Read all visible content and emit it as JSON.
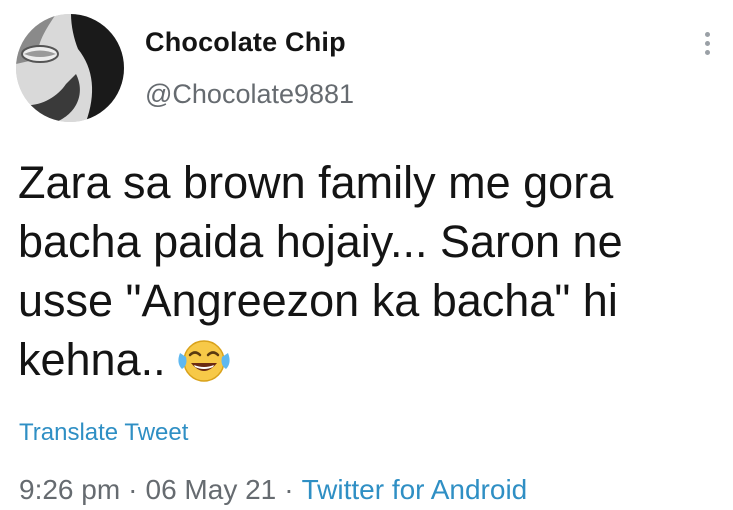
{
  "tweet": {
    "author_name": "Chocolate Chip",
    "author_handle": "@Chocolate9881",
    "text": "Zara sa brown family me gora\nbacha paida hojaiy... Saron ne\nusse \"Angreezon ka bacha\" hi\nkehna..",
    "emoji": "face-with-tears-of-joy-icon",
    "translate_label": "Translate Tweet",
    "time": "9:26 pm",
    "date": "06 May 21",
    "source": "Twitter for Android",
    "separator": "·"
  },
  "icons": {
    "more": "more-vertical-icon",
    "avatar": "avatar"
  },
  "colors": {
    "link": "#2f8fc4",
    "muted": "#666b70",
    "text": "#141414"
  }
}
